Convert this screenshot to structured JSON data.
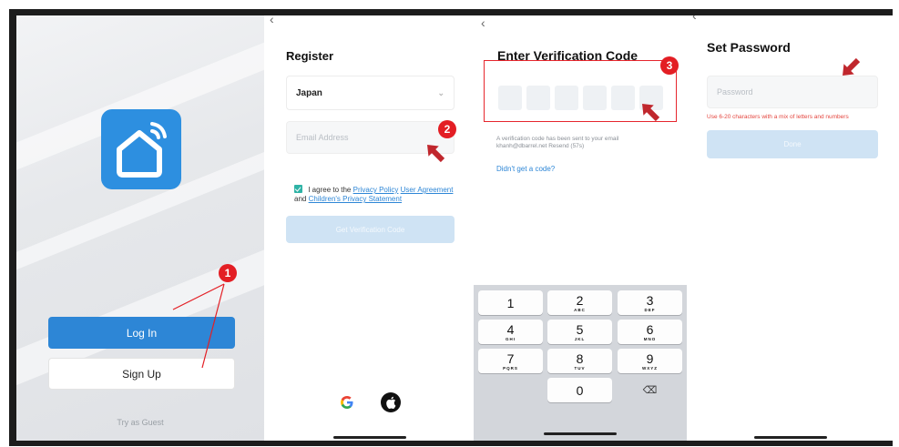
{
  "screen1": {
    "login_label": "Log In",
    "signup_label": "Sign Up",
    "guest_label": "Try as Guest",
    "brand_color": "#2d8fe0"
  },
  "screen2": {
    "title": "Register",
    "country": "Japan",
    "email_placeholder": "Email Address",
    "agree_prefix": "I agree to the",
    "privacy_policy": "Privacy Policy",
    "user_agreement": "User Agreement",
    "and": "and",
    "childrens_privacy": "Children's Privacy Statement",
    "get_code_label": "Get Verification Code",
    "social_icons": [
      "google-icon",
      "apple-icon"
    ]
  },
  "screen3": {
    "title": "Enter Verification Code",
    "info_text": "A verification code has been sent to your email khanh@dbarrel.net  Resend (57s)",
    "didnt_get": "Didn't get a code?",
    "keys": [
      {
        "num": "1",
        "letters": ""
      },
      {
        "num": "2",
        "letters": "ABC"
      },
      {
        "num": "3",
        "letters": "DEF"
      },
      {
        "num": "4",
        "letters": "GHI"
      },
      {
        "num": "5",
        "letters": "JKL"
      },
      {
        "num": "6",
        "letters": "MNO"
      },
      {
        "num": "7",
        "letters": "PQRS"
      },
      {
        "num": "8",
        "letters": "TUV"
      },
      {
        "num": "9",
        "letters": "WXYZ"
      },
      {
        "num": "0",
        "letters": ""
      }
    ],
    "delete_glyph": "⌫"
  },
  "screen4": {
    "title": "Set Password",
    "password_placeholder": "Password",
    "hint": "Use 6-20 characters with a mix of letters and numbers",
    "done_label": "Done"
  },
  "markers": {
    "m1": "1",
    "m2": "2",
    "m3": "3",
    "color": "#e31e24"
  },
  "back_glyph": "‹"
}
